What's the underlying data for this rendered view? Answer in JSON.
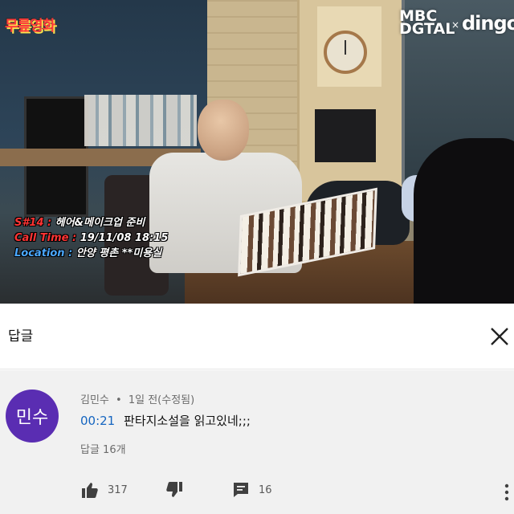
{
  "video": {
    "channel_logo_left": "무릎영화",
    "brand_mbc_line1": "MBC",
    "brand_mbc_line2": "DGTAL",
    "brand_separator": "×",
    "brand_dingo": "dingo",
    "caption": {
      "scene_label": "S#14 :",
      "scene_value": "헤어&메이크업 준비",
      "calltime_label": "Call Time :",
      "calltime_value": "19/11/08 18:15",
      "location_label": "Location :",
      "location_value": "안양 평촌 **미용실"
    }
  },
  "panel": {
    "title": "답글",
    "close_icon": "close-icon"
  },
  "comment": {
    "avatar_text": "민수",
    "avatar_color": "#5a2db2",
    "author": "김민수",
    "separator": "•",
    "time": "1일 전(수정됨)",
    "timestamp": "00:21",
    "text": "판타지소설을 읽고있네;;;",
    "reply_count_label": "답글 16개",
    "likes": "317",
    "replies": "16",
    "timestamp_color": "#1565c0"
  }
}
